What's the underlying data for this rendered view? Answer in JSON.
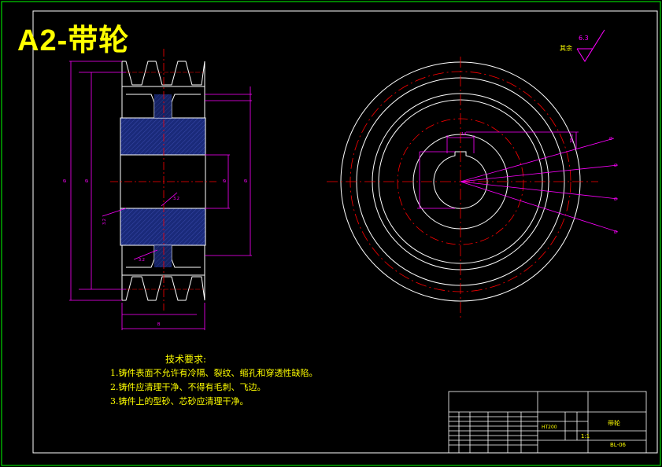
{
  "title": "A2-带轮",
  "tech_requirements": {
    "heading": "技术要求:",
    "items": [
      "1.铸件表面不允许有冷隔、裂纹、缩孔和穿透性缺陷。",
      "2.铸件应清理干净、不得有毛刺、飞边。",
      "3.铸件上的型砂、芯砂应清理干净。"
    ]
  },
  "surface_roughness": {
    "value": "6.3",
    "label": "其余"
  },
  "title_block": {
    "part_name": "带轮",
    "drawing_no": "BL-06",
    "scale": "1:1",
    "material": "HT200"
  },
  "colors": {
    "background": "#000000",
    "outline": "#ffffff",
    "dimension": "#ff00ff",
    "centerline": "#ff0000",
    "hatch": "#1a237e",
    "text": "#ffff00",
    "border": "#00ff00"
  }
}
